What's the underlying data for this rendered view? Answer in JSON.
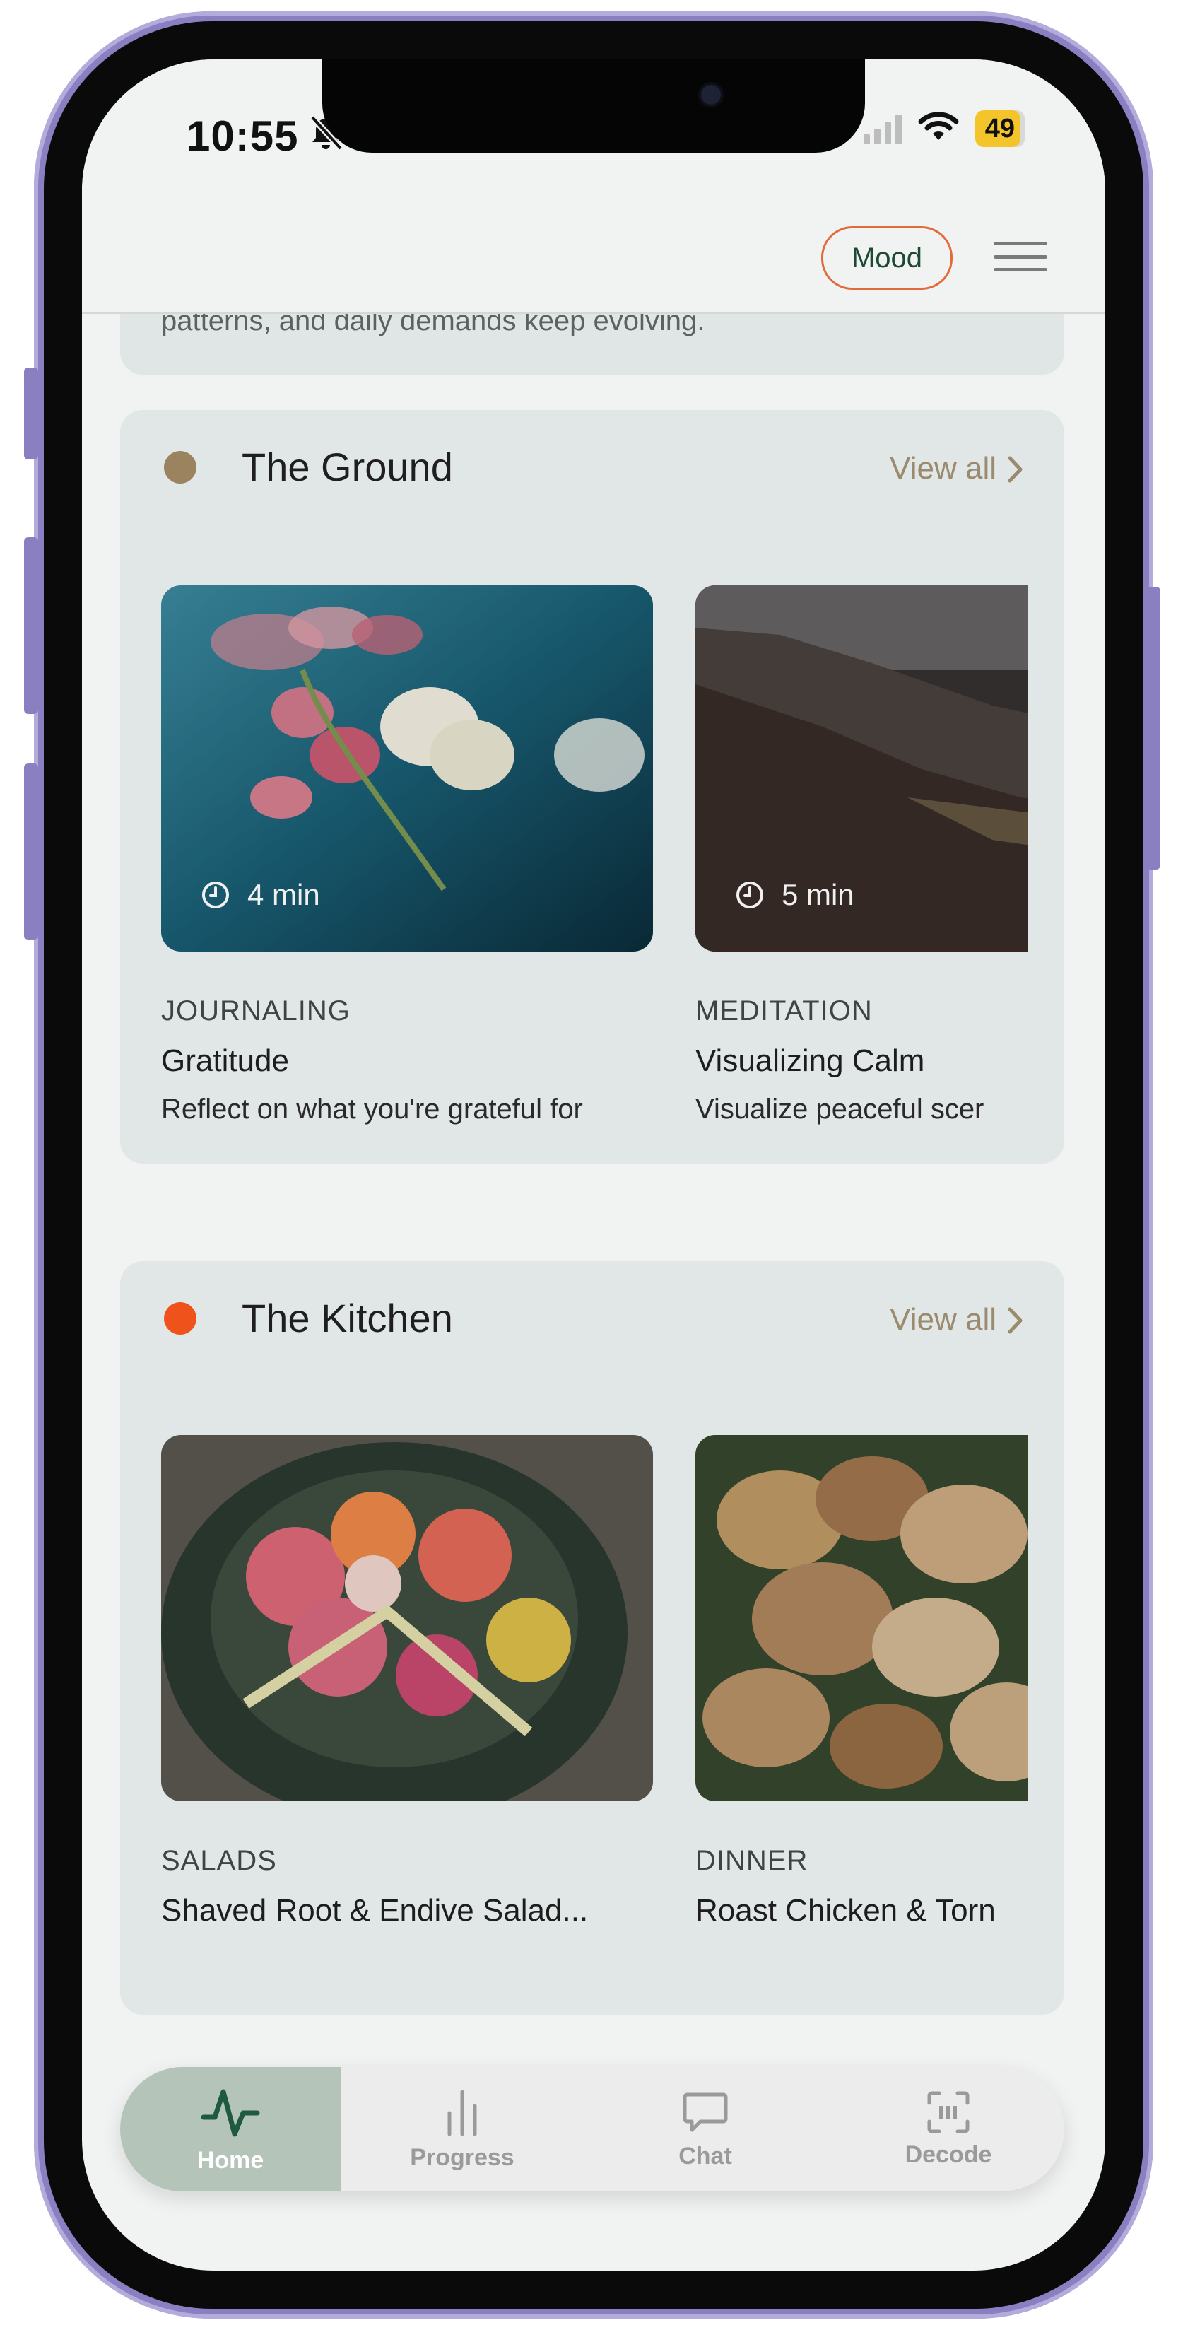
{
  "status_bar": {
    "time": "10:55",
    "battery": "49"
  },
  "header": {
    "mood_label": "Mood",
    "prev_card_text": "patterns, and daily demands keep evolving."
  },
  "colors": {
    "ground_dot": "#9b8360",
    "kitchen_dot": "#f0521b",
    "accent_view_all": "#9a8b6e",
    "home_active": "#b5c4b9"
  },
  "sections": [
    {
      "title": "The Ground",
      "view_all": "View all",
      "cards": [
        {
          "category": "JOURNALING",
          "title": "Gratitude",
          "description": "Reflect on what you're grateful for",
          "duration": "4 min"
        },
        {
          "category": "MEDITATION",
          "title": "Visualizing Calm",
          "description": "Visualize peaceful scer",
          "duration": "5 min"
        }
      ]
    },
    {
      "title": "The Kitchen",
      "view_all": "View all",
      "cards": [
        {
          "category": "SALADS",
          "title": "Shaved Root & Endive Salad..."
        },
        {
          "category": "DINNER",
          "title": "Roast Chicken & Torn"
        }
      ]
    }
  ],
  "nav": {
    "items": [
      {
        "label": "Home",
        "icon": "activity-icon",
        "active": true
      },
      {
        "label": "Progress",
        "icon": "bar-chart-icon"
      },
      {
        "label": "Chat",
        "icon": "chat-bubble-icon"
      },
      {
        "label": "Decode",
        "icon": "scan-icon"
      }
    ]
  }
}
